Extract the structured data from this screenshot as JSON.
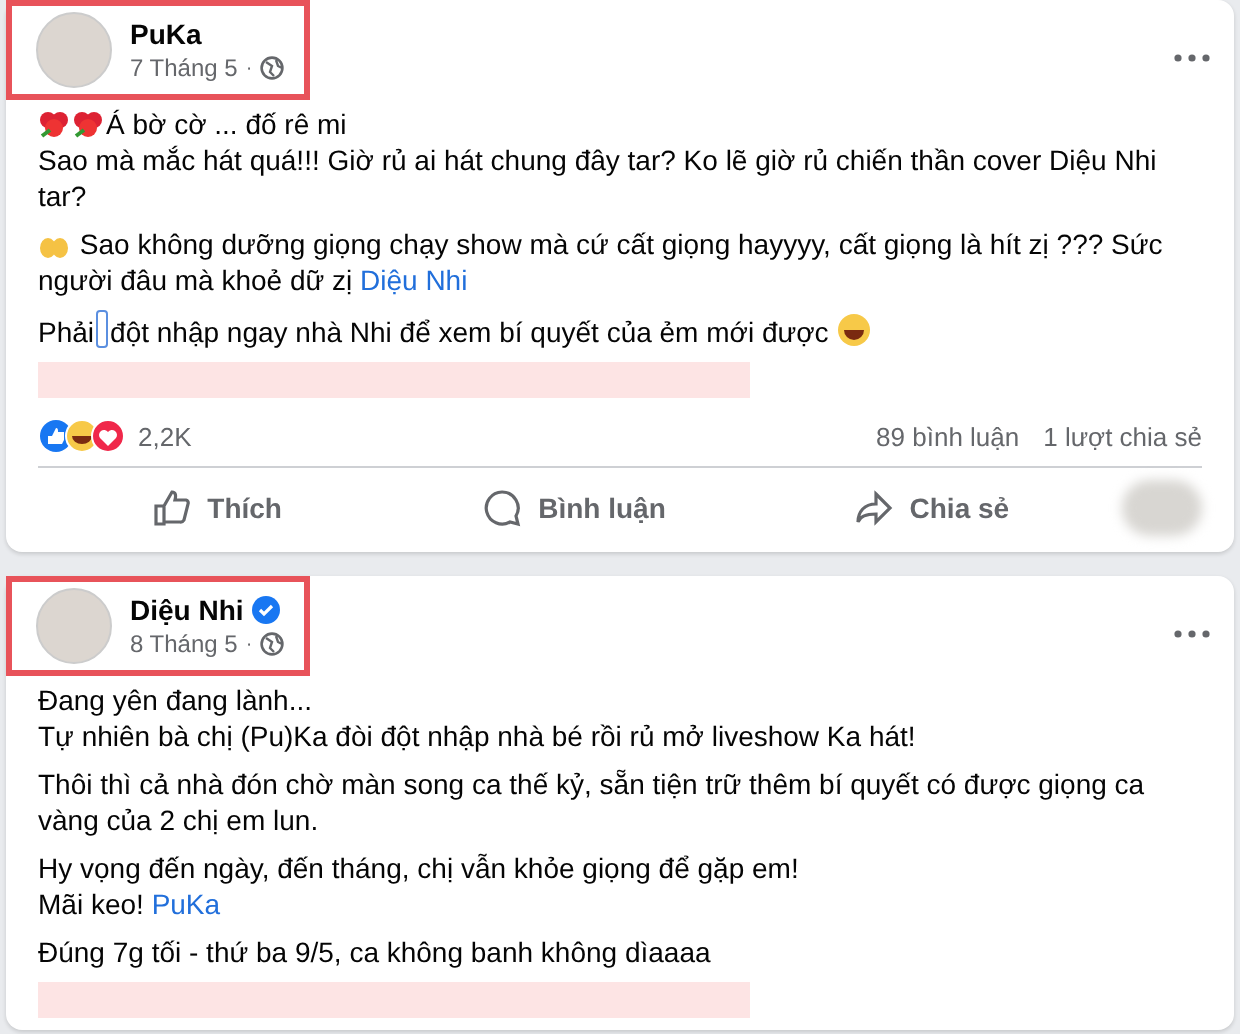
{
  "posts": [
    {
      "author": "PuKa",
      "verified": false,
      "date": "7 Tháng 5",
      "date_separator": "·",
      "highlighted": true,
      "redacted_line": true,
      "paragraphs": [
        [
          {
            "kind": "flower"
          },
          {
            "kind": "flower"
          },
          {
            "kind": "text",
            "text": "Á bờ cờ ... đố rê mi"
          },
          {
            "kind": "break"
          },
          {
            "kind": "text",
            "text": "Sao mà mắc hát quá!!! Giờ rủ ai hát chung đây tar? Ko lẽ giờ rủ chiến thần cover Diệu Nhi tar?"
          }
        ],
        [
          {
            "kind": "hands"
          },
          {
            "kind": "text",
            "text": " Sao không dưỡng giọng chạy show mà cứ cất giọng hayyyy, cất giọng là hít zị ??? Sức người đâu mà khoẻ dữ zị "
          },
          {
            "kind": "link",
            "text": "Diệu Nhi"
          }
        ],
        [
          {
            "kind": "text",
            "text": "Phải"
          },
          {
            "kind": "cursor"
          },
          {
            "kind": "text",
            "text": "đột nhập ngay nhà Nhi để xem bí quyết của ẻm mới được "
          },
          {
            "kind": "laugh"
          }
        ]
      ],
      "stats": {
        "reactions": "2,2K",
        "comments": "89 bình luận",
        "shares": "1 lượt chia sẻ"
      },
      "actions": [
        {
          "kind": "like",
          "label": "Thích"
        },
        {
          "kind": "comment",
          "label": "Bình luận"
        },
        {
          "kind": "share",
          "label": "Chia sẻ"
        }
      ]
    },
    {
      "author": "Diệu Nhi",
      "verified": true,
      "date": "8 Tháng 5",
      "date_separator": "·",
      "highlighted": true,
      "redacted_line": true,
      "paragraphs": [
        [
          {
            "kind": "text",
            "text": "Đang yên đang lành..."
          },
          {
            "kind": "break"
          },
          {
            "kind": "text",
            "text": "Tự nhiên bà chị (Pu)Ka đòi đột nhập nhà bé rồi rủ mở liveshow Ka hát!"
          }
        ],
        [
          {
            "kind": "text",
            "text": "Thôi thì cả nhà đón chờ màn song ca thế kỷ, sẵn tiện trữ thêm bí quyết có được giọng ca vàng của 2 chị em lun."
          }
        ],
        [
          {
            "kind": "text",
            "text": "Hy vọng đến ngày, đến tháng, chị vẫn khỏe giọng để gặp em!"
          },
          {
            "kind": "break"
          },
          {
            "kind": "text",
            "text": "Mãi keo! "
          },
          {
            "kind": "link",
            "text": "PuKa"
          }
        ],
        [
          {
            "kind": "text",
            "text": "Đúng 7g tối - thứ ba 9/5, ca không banh không dìaaaa"
          }
        ]
      ]
    }
  ]
}
